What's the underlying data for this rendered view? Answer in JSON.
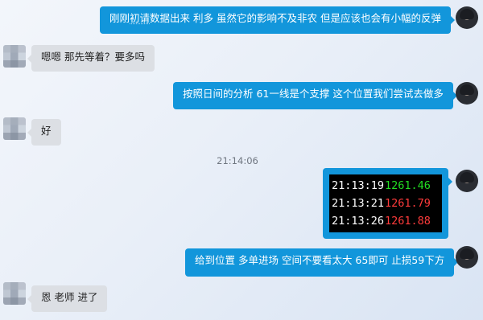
{
  "chat": {
    "messages": [
      {
        "side": "out",
        "text_parts": [
          "刚刚",
          "初请",
          "数据出来 利多 虽然它的影响不及非农 但是应该也会有小幅的反弹"
        ]
      },
      {
        "side": "in",
        "text": "嗯嗯 那先等着？要多吗"
      },
      {
        "side": "out",
        "text": "按照日间的分析 61一线是个支撑 这个位置我们尝试去做多"
      },
      {
        "side": "in",
        "text": "好"
      },
      {
        "side": "out",
        "text": "给到位置 多单进场 空间不要看太大 65即可 止损59下方"
      },
      {
        "side": "in",
        "text": "恩 老师 进了"
      }
    ],
    "timestamp": "21:14:06",
    "quotes": [
      {
        "time": "21:13:19",
        "price": "1261.46",
        "color": "#22dd22"
      },
      {
        "time": "21:13:21",
        "price": "1261.79",
        "color": "#ff3b3b"
      },
      {
        "time": "21:13:26",
        "price": "1261.88",
        "color": "#ff3b3b"
      }
    ]
  },
  "colors": {
    "outgoing_bubble": "#1296db",
    "incoming_bubble": "#dcdfe4"
  },
  "icons": {
    "teacher_avatar": "teacher-avatar-icon",
    "user_avatar": "user-avatar-icon"
  }
}
